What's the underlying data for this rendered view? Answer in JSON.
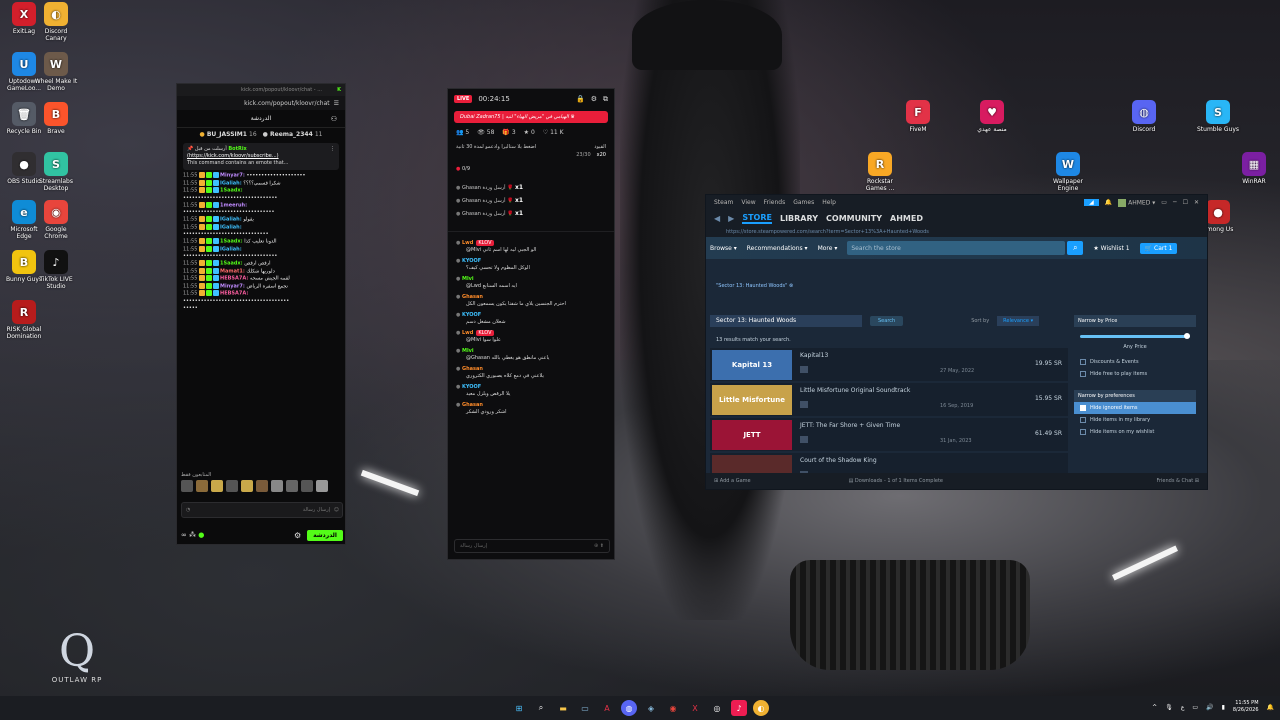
{
  "desktop": {
    "icons_left": [
      {
        "name": "ExitLag",
        "color": "#d21f2b",
        "glyph": "X"
      },
      {
        "name": "Discord Canary",
        "color": "#f0b132",
        "glyph": "◐"
      },
      {
        "name": "Uptodown GameLoo...",
        "color": "#1e88e5",
        "glyph": "U"
      },
      {
        "name": "Wheel Make It Demo",
        "color": "#6d5a4a",
        "glyph": "W"
      },
      {
        "name": "Recycle Bin",
        "color": "#555b66",
        "glyph": "🗑"
      },
      {
        "name": "Brave",
        "color": "#fb542b",
        "glyph": "B"
      },
      {
        "name": "OBS Studio",
        "color": "#302e31",
        "glyph": "●"
      },
      {
        "name": "Streamlabs Desktop",
        "color": "#31c3a2",
        "glyph": "S"
      },
      {
        "name": "Microsoft Edge",
        "color": "#0f8cd6",
        "glyph": "e"
      },
      {
        "name": "Google Chrome",
        "color": "#e8453c",
        "glyph": "◉"
      },
      {
        "name": "Bunny Guys",
        "color": "#f1c40f",
        "glyph": "B"
      },
      {
        "name": "TikTok LIVE Studio",
        "color": "#111",
        "glyph": "♪"
      },
      {
        "name": "RISK Global Domination",
        "color": "#b71c1c",
        "glyph": "R"
      }
    ],
    "icons_right": [
      {
        "name": "FiveM",
        "color": "#e23247",
        "glyph": "F"
      },
      {
        "name": "منصة عهدي",
        "color": "#d81b60",
        "glyph": "♥"
      },
      {
        "name": "Discord",
        "color": "#5865f2",
        "glyph": "◍"
      },
      {
        "name": "Stumble Guys",
        "color": "#29b6f6",
        "glyph": "S"
      },
      {
        "name": "Rockstar Games ...",
        "color": "#f9a825",
        "glyph": "R"
      },
      {
        "name": "Wallpaper Engine",
        "color": "#1e88e5",
        "glyph": "W"
      },
      {
        "name": "WinRAR",
        "color": "#7b1fa2",
        "glyph": "▦"
      },
      {
        "name": "Among Us",
        "color": "#c62828",
        "glyph": "●"
      }
    ],
    "logo_text": "OUTLAW RP"
  },
  "kick_chat": {
    "window_url": "kick.com/popout/kloovr/chat - ...",
    "url": "kick.com/popout/kloovr/chat",
    "header": "الدردشة",
    "gifters": [
      {
        "name": "BU_JASSIM1",
        "count": "16"
      },
      {
        "name": "Reema_2344",
        "count": "11"
      }
    ],
    "pinned": {
      "line1_user": "BotRix",
      "line1_prefix": "أرسلت من قبل",
      "link": "(https://kick.com/kloovr/subscribe...)",
      "text": "This command contains an emote that..."
    },
    "messages": [
      {
        "time": "11:55",
        "user": "Minyar7:",
        "text": "••••••••••••••••••••",
        "color": "#c08bff"
      },
      {
        "time": "11:55",
        "user": "IGaliah:",
        "text": "شكرا قسمي؟؟؟؟",
        "color": "#3ec1ff"
      },
      {
        "time": "11:55",
        "user": "1Saadx:",
        "text": "",
        "color": "#53fc18"
      },
      {
        "time": "",
        "user": "",
        "text": "••••••••••••••••••••••••••••••••",
        "color": "#eee"
      },
      {
        "time": "11:55",
        "user": "1meeruh:",
        "text": "",
        "color": "#c08bff"
      },
      {
        "time": "",
        "user": "",
        "text": "•••••••••••••••••••••••••••••••",
        "color": "#eee"
      },
      {
        "time": "11:55",
        "user": "IGaliah:",
        "text": "يقولو",
        "color": "#3ec1ff"
      },
      {
        "time": "11:55",
        "user": "IGaliah:",
        "text": "",
        "color": "#3ec1ff"
      },
      {
        "time": "",
        "user": "",
        "text": "•••••••••••••••••••••••••••••",
        "color": "#eee"
      },
      {
        "time": "11:55",
        "user": "1Saadx:",
        "text": "الدونا تعليب كذا",
        "color": "#53fc18"
      },
      {
        "time": "11:55",
        "user": "IGaliah:",
        "text": "",
        "color": "#3ec1ff"
      },
      {
        "time": "",
        "user": "",
        "text": "••••••••••••••••••••••••••••••••",
        "color": "#eee"
      },
      {
        "time": "11:55",
        "user": "1Saadx:",
        "text": "ارقص ارقص",
        "color": "#53fc18"
      },
      {
        "time": "11:55",
        "user": "Mamat1:",
        "text": "دلوريها شكلك",
        "color": "#ff6b6b"
      },
      {
        "time": "11:55",
        "user": "HEBSA7A:",
        "text": "لقمه الجيش مسحه",
        "color": "#ff5fa2"
      },
      {
        "time": "11:55",
        "user": "Minyar7:",
        "text": "تجمع اسفره الرياض",
        "color": "#c08bff"
      },
      {
        "time": "11:55",
        "user": "HEBSA7A:",
        "text": "",
        "color": "#ff5fa2"
      },
      {
        "time": "",
        "user": "",
        "text": "••••••••••••••••••••••••••••••••••••",
        "color": "#eee"
      },
      {
        "time": "",
        "user": "",
        "text": "•••••",
        "color": "#eee"
      }
    ],
    "emotes_label": "المتابعون فقط",
    "input_placeholder": "إرسال رسالة",
    "chat_button": "الدردشة"
  },
  "live_panel": {
    "live_label": "LIVE",
    "elapsed": "00:24:15",
    "title": "Dubai Zadran75 | الهيامي في \"مريض الهياء\" لنبه ♛",
    "stats": [
      {
        "icon": "👥",
        "value": "5"
      },
      {
        "icon": "👁",
        "value": "58"
      },
      {
        "icon": "🎁",
        "value": "3"
      },
      {
        "icon": "★",
        "value": "0"
      },
      {
        "icon": "♡",
        "value": "11 K"
      }
    ],
    "goal_text": "اضغط يلا ستاليرا وادعمو لمدة 30 ثانية",
    "goal_right": "القيود",
    "goal_progress": "23/30",
    "goal_multiplier": "x20",
    "count_badge": "0/9",
    "events": [
      {
        "user": "Ghasan",
        "text": "أرسل وردة",
        "mult": "x1"
      },
      {
        "user": "Ghasan",
        "text": "أرسل وردة",
        "mult": "x1"
      },
      {
        "user": "Ghasan",
        "text": "أرسل وردة",
        "mult": "x1"
      }
    ],
    "messages": [
      {
        "user": "Lwd",
        "badge": "KLOV",
        "text": "@Mlvi الو الجبي ليه لها اسم ثاني",
        "cls": "o"
      },
      {
        "user": "KYOOF",
        "badge": "",
        "text": "الوكل المظوم ولا تحسي كيف؟",
        "cls": ""
      },
      {
        "user": "Mlvi",
        "badge": "",
        "text": "@Lwd ايه اسمه السنابع",
        "cls": "g"
      },
      {
        "user": "Ghasan",
        "badge": "",
        "text": "احترم الجنسين يلاي ما شفتا يكون يسمعون الكل",
        "cls": "o"
      },
      {
        "user": "KYOOF",
        "badge": "",
        "text": "شعلان مشغل دسم",
        "cls": ""
      },
      {
        "user": "Lwd",
        "badge": "KLOV",
        "text": "@Mlvi علوا سوا",
        "cls": "o"
      },
      {
        "user": "Mlvi",
        "badge": "",
        "text": "@Ghasan ياعني مانطق هو يغطي بالله",
        "cls": "g"
      },
      {
        "user": "Ghasan",
        "badge": "",
        "text": "يلاعني في دمع كلاه يصبوري الكثروري",
        "cls": "o"
      },
      {
        "user": "KYOOF",
        "badge": "",
        "text": "يلا الرقص ويلزل معيد",
        "cls": ""
      },
      {
        "user": "Ghasan",
        "badge": "",
        "text": "اشكر ورودي الشكر",
        "cls": "o"
      }
    ],
    "input_placeholder": "إرسال رسالة"
  },
  "steam": {
    "menu": [
      "Steam",
      "View",
      "Friends",
      "Games",
      "Help"
    ],
    "account": "AHMED",
    "nav": [
      "STORE",
      "LIBRARY",
      "COMMUNITY",
      "AHMED"
    ],
    "url": "https://store.steampowered.com/search?term=Sector+13%3A+Haunted+Woods",
    "subnav": [
      "Browse",
      "Recommendations",
      "More"
    ],
    "search_placeholder": "Search the store",
    "wishlist": "Wishlist",
    "wishlist_count": "1",
    "cart": "Cart",
    "cart_count": "1",
    "breadcrumb": "\"Sector 13: Haunted Woods\"",
    "query": "Sector 13: Haunted Woods",
    "search_button": "Search",
    "sort_label": "Sort by",
    "sort_value": "Relevance",
    "results_count": "13 results match your search.",
    "results": [
      {
        "name": "Kapital13",
        "date": "27 May, 2022",
        "price": "19.95 SR",
        "cap": "Kapital 13",
        "capcolor": "#3c6fae"
      },
      {
        "name": "Little Misfortune Original Soundtrack",
        "date": "16 Sep, 2019",
        "price": "15.95 SR",
        "cap": "Little Misfortune",
        "capcolor": "#c8a24a"
      },
      {
        "name": "JETT: The Far Shore + Given Time",
        "date": "31 Jan, 2023",
        "price": "61.49 SR",
        "cap": "JETT",
        "capcolor": "#9b1436"
      },
      {
        "name": "Court of the Shadow King",
        "date": "",
        "price": "",
        "cap": "",
        "capcolor": "#5a2a2a"
      }
    ],
    "price_filter_title": "Narrow by Price",
    "any_price": "Any Price",
    "price_options": [
      "Discounts & Events",
      "Hide free to play items"
    ],
    "pref_title": "Narrow by preferences",
    "pref_options": [
      {
        "label": "Hide ignored items",
        "checked": true
      },
      {
        "label": "Hide items in my library",
        "checked": false
      },
      {
        "label": "Hide items on my wishlist",
        "checked": false
      }
    ],
    "add_game": "Add a Game",
    "downloads": "Downloads - 1 of 1 Items Complete",
    "friends": "Friends & Chat"
  },
  "taskbar": {
    "time": "11:55 PM",
    "date": "8/26/2026",
    "lang": "ع"
  }
}
